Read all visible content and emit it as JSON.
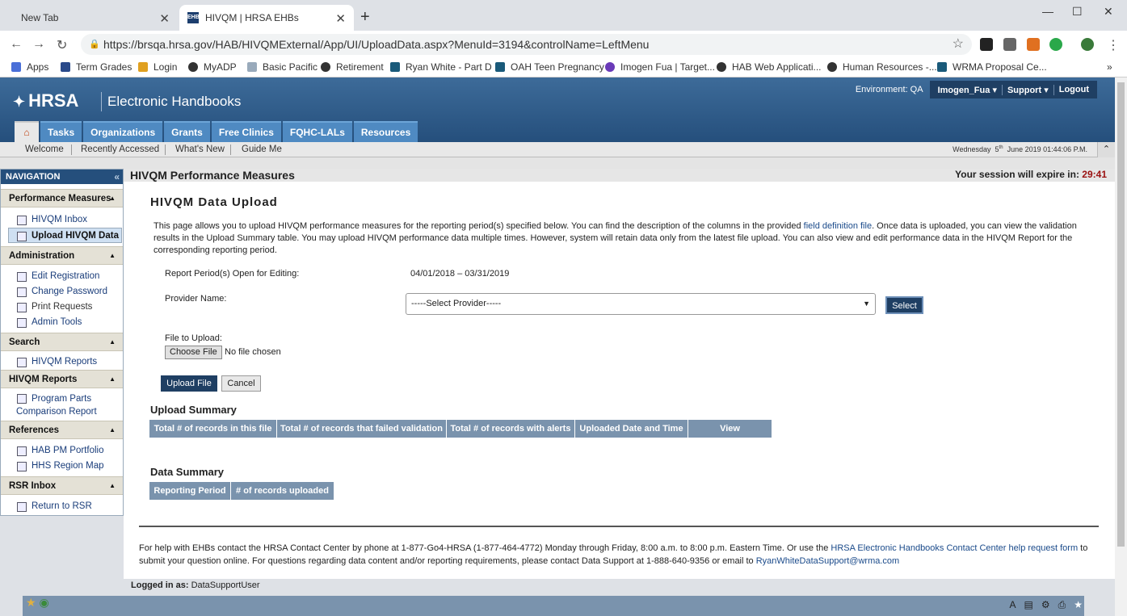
{
  "browser": {
    "tabs": [
      {
        "title": "New Tab",
        "favicon": ""
      },
      {
        "title": "HIVQM | HRSA EHBs",
        "favicon": "EHB"
      }
    ],
    "url": "https://brsqa.hrsa.gov/HAB/HIVQMExternal/App/UI/UploadData.aspx?MenuId=3194&controlName=LeftMenu",
    "bookmarks": [
      "Apps",
      "Term Grades",
      "Login",
      "MyADP",
      "Basic Pacific",
      "Retirement",
      "Ryan White - Part D",
      "OAH Teen Pregnancy",
      "Imogen Fua | Target...",
      "HAB Web Applicati...",
      "Human Resources -...",
      "WRMA Proposal Ce..."
    ]
  },
  "header": {
    "logo": "HRSA",
    "title": "Electronic Handbooks",
    "environment": "Environment: QA",
    "user": "Imogen_Fua",
    "support": "Support",
    "logout": "Logout",
    "main_nav": [
      "Tasks",
      "Organizations",
      "Grants",
      "Free Clinics",
      "FQHC-LALs",
      "Resources"
    ],
    "sub_nav": [
      "Welcome",
      "Recently Accessed",
      "What's New",
      "Guide Me"
    ],
    "datetime_day": "Wednesday",
    "datetime_date": "5",
    "datetime_sup": "th",
    "datetime_rest": "June 2019 01:44:06 P.M."
  },
  "leftnav": {
    "title": "NAVIGATION",
    "sections": [
      {
        "title": "Performance Measures",
        "items": [
          "HIVQM Inbox",
          "Upload HIVQM Data"
        ]
      },
      {
        "title": "Administration",
        "items": [
          "Edit Registration",
          "Change Password",
          "Print Requests",
          "Admin Tools"
        ]
      },
      {
        "title": "Search",
        "items": [
          "HIVQM Reports"
        ]
      },
      {
        "title": "HIVQM Reports",
        "items": [
          "Program Parts",
          "Comparison Report"
        ]
      },
      {
        "title": "References",
        "items": [
          "HAB PM Portfolio",
          "HHS Region Map"
        ]
      },
      {
        "title": "RSR Inbox",
        "items": [
          "Return to RSR"
        ]
      }
    ]
  },
  "page": {
    "section_title": "HIVQM Performance Measures",
    "session_label": "Your session will expire in:",
    "session_time": "29:41",
    "title": "HIVQM Data Upload",
    "intro_1": "This page allows you to upload HIVQM performance measures for the reporting period(s) specified below. You can find the description of the columns in the provided ",
    "intro_link": "field definition file",
    "intro_2": ". Once data is uploaded, you can view the validation results in the Upload Summary table. You may upload HIVQM performance data multiple times. However, system will retain data only from the latest file upload. You can also view and edit performance data in the HIVQM Report for the corresponding reporting period.",
    "report_period_label": "Report Period(s) Open for Editing:",
    "report_period_value": "04/01/2018 – 03/31/2019",
    "provider_label": "Provider Name:",
    "provider_selected": "-----Select Provider-----",
    "select_btn": "Select",
    "file_label": "File to Upload:",
    "choose_file": "Choose File",
    "no_file": "No file chosen",
    "upload_btn": "Upload File",
    "cancel_btn": "Cancel",
    "upload_summary_title": "Upload Summary",
    "upload_summary_cols": [
      "Total # of records in this file",
      "Total # of records that failed validation",
      "Total # of records with alerts",
      "Uploaded Date and Time",
      "View"
    ],
    "data_summary_title": "Data Summary",
    "data_summary_cols": [
      "Reporting Period",
      "# of records uploaded"
    ],
    "help_1": "For help with EHBs contact the HRSA Contact Center by phone at 1-877-Go4-HRSA (1-877-464-4772) Monday through Friday, 8:00 a.m. to 8:00 p.m. Eastern Time. Or use the ",
    "help_link1": "HRSA Electronic Handbooks Contact Center help request form",
    "help_2": " to submit your question online. For questions regarding data content and/or reporting requirements, please contact Data Support at 1-888-640-9356 or email to ",
    "help_link2": "RyanWhiteDataSupport@wrma.com",
    "logged_in_label": "Logged in as:",
    "logged_in_user": "DataSupportUser"
  },
  "colors": {
    "brand": "#254f7c",
    "tab": "#4f8ac2",
    "grid_header": "#7a93ad",
    "session_time": "#9a1010"
  }
}
